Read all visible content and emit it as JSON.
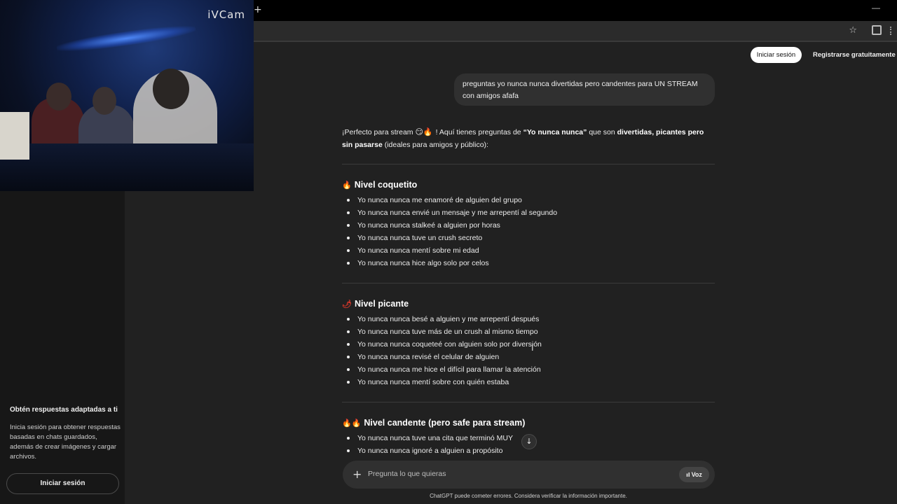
{
  "browser": {
    "new_tab_icon": "plus-icon",
    "bookmark_icon": "star-icon",
    "extensions_icon": "puzzle-icon"
  },
  "webcam": {
    "logo": "iVCam"
  },
  "header": {
    "login_label": "Iniciar sesión",
    "register_label": "Registrarse gratuitamente"
  },
  "sidebar": {
    "promo_title": "Obtén respuestas adaptadas a ti",
    "promo_text": "Inicia sesión para obtener respuestas basadas en chats guardados, además de crear imágenes y cargar archivos.",
    "login_label": "Iniciar sesión"
  },
  "conversation": {
    "user_message": "preguntas yo nunca nunca divertidas pero candentes para UN STREAM con amigos afafa",
    "intro": {
      "part1": "¡Perfecto para stream ",
      "emojis": "😏🔥",
      "part2": "! Aquí tienes preguntas de ",
      "bold1": "“Yo nunca nunca”",
      "part3": " que son ",
      "bold2": "divertidas, picantes pero sin pasarse",
      "part4": " (ideales para amigos y público):"
    },
    "sections": [
      {
        "title": "Nivel coquetito",
        "icon": "🔥",
        "items": [
          "Yo nunca nunca me enamoré de alguien del grupo",
          "Yo nunca nunca envié un mensaje y me arrepentí al segundo",
          "Yo nunca nunca stalkeé a alguien por horas",
          "Yo nunca nunca tuve un crush secreto",
          "Yo nunca nunca mentí sobre mi edad",
          "Yo nunca nunca hice algo solo por celos"
        ]
      },
      {
        "title": "Nivel picante",
        "icon": "🌶",
        "items": [
          "Yo nunca nunca besé a alguien y me arrepentí después",
          "Yo nunca nunca tuve más de un crush al mismo tiempo",
          "Yo nunca nunca coqueteé con alguien solo por diversión",
          "Yo nunca nunca revisé el celular de alguien",
          "Yo nunca nunca me hice el difícil para llamar la atención",
          "Yo nunca nunca mentí sobre con quién estaba"
        ]
      },
      {
        "title": "Nivel candente (pero safe para stream)",
        "icon": "🔥🔥",
        "items": [
          "Yo nunca nunca tuve una cita que terminó MUY",
          "Yo nunca nunca ignoré a alguien a propósito"
        ]
      }
    ]
  },
  "composer": {
    "placeholder": "Pregunta lo que quieras",
    "voice_label": "Voz"
  },
  "footer": {
    "disclaimer": "ChatGPT puede cometer errores. Considera verificar la información importante."
  },
  "colors": {
    "background": "#212121",
    "sidebar": "#171717",
    "bubble": "#303030",
    "accent_fire": "#ff7a1a"
  }
}
